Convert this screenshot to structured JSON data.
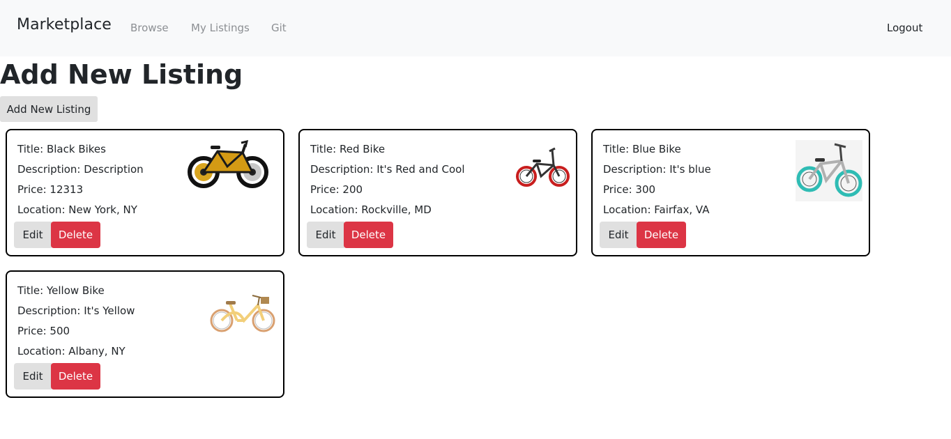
{
  "navbar": {
    "brand": "Marketplace",
    "links": [
      "Browse",
      "My Listings",
      "Git"
    ],
    "logout": "Logout"
  },
  "page": {
    "title": "Add New Listing",
    "add_button": "Add New Listing"
  },
  "actions": {
    "edit": "Edit",
    "delete": "Delete"
  },
  "listings": [
    {
      "title": "Title: Black Bikes",
      "description": "Description: Description",
      "price": "Price: 12313",
      "location": "Location: New York, NY",
      "image": "black-yellow-bike-image"
    },
    {
      "title": "Title: Red Bike",
      "description": "Description: It's Red and Cool",
      "price": "Price: 200",
      "location": "Location: Rockville, MD",
      "image": "red-bmx-bike-image"
    },
    {
      "title": "Title: Blue Bike",
      "description": "Description: It's blue",
      "price": "Price: 300",
      "location": "Location: Fairfax, VA",
      "image": "teal-bmx-bike-image"
    },
    {
      "title": "Title: Yellow Bike",
      "description": "Description: It's Yellow",
      "price": "Price: 500",
      "location": "Location: Albany, NY",
      "image": "yellow-cruiser-bike-image"
    }
  ],
  "colors": {
    "navbar_bg": "#f8f9fa",
    "delete_button": "#dc3545",
    "secondary_button": "#e0e0e0",
    "card_border": "#000000"
  }
}
